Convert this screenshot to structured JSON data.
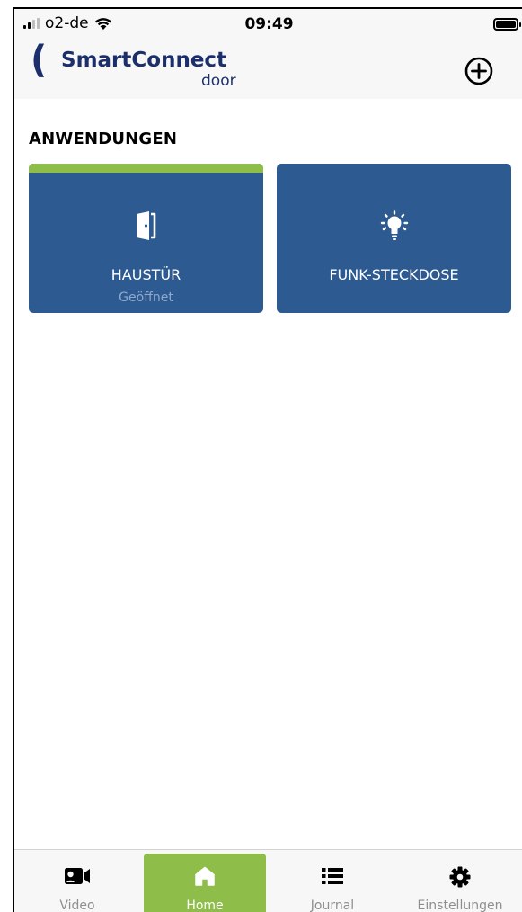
{
  "status_bar": {
    "carrier": "o2-de",
    "time": "09:49"
  },
  "header": {
    "logo_paren": "(",
    "logo_name": "SmartConnect",
    "logo_sub": "door",
    "add_icon": "plus-circle-icon"
  },
  "main": {
    "section_title": "ANWENDUNGEN",
    "tiles": [
      {
        "label": "HAUSTÜR",
        "status": "Geöffnet",
        "icon": "door-icon",
        "active": true
      },
      {
        "label": "FUNK-STECKDOSE",
        "icon": "light-bulb-icon",
        "active": false
      }
    ]
  },
  "tabbar": {
    "tabs": [
      {
        "label": "Video",
        "icon": "video-camera-icon",
        "active": false
      },
      {
        "label": "Home",
        "icon": "home-icon",
        "active": true
      },
      {
        "label": "Journal",
        "icon": "list-icon",
        "active": false
      },
      {
        "label": "Einstellungen",
        "icon": "gear-icon",
        "active": false
      }
    ]
  },
  "colors": {
    "brand_navy": "#1d2f6b",
    "tile_blue": "#2d5a91",
    "accent_green": "#8ebd4a"
  }
}
